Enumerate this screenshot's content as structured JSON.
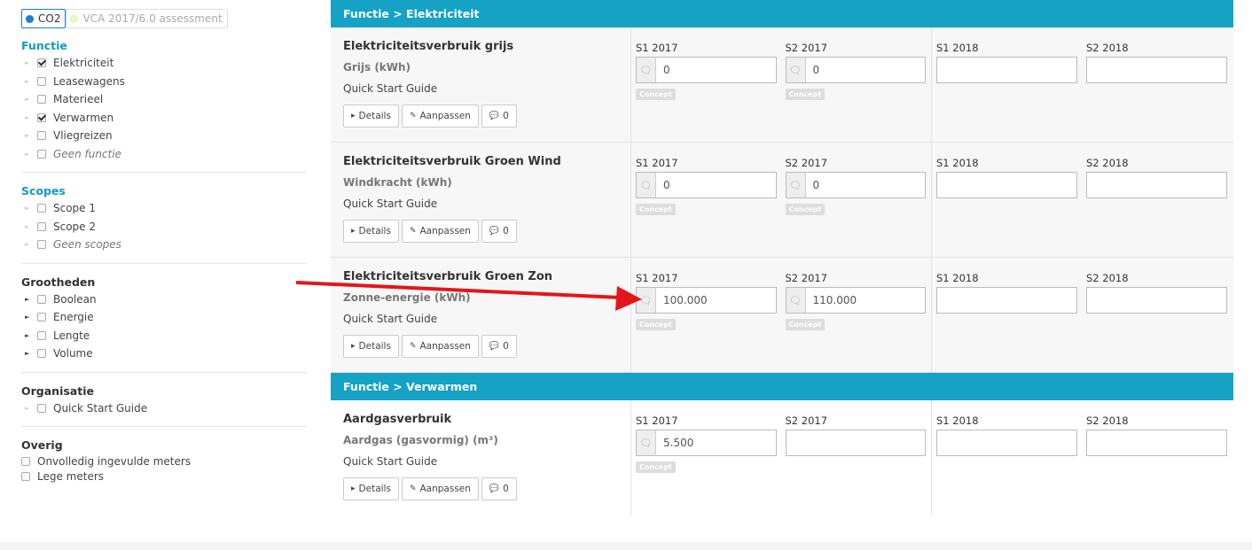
{
  "sidebar": {
    "tabs": [
      {
        "label": "CO2",
        "active": true
      },
      {
        "label": "VCA 2017/6.0 assessment",
        "active": false
      }
    ],
    "sections": [
      {
        "title": "Functie",
        "items": [
          {
            "label": "Elektriciteit",
            "checked": true
          },
          {
            "label": "Leasewagens",
            "checked": false
          },
          {
            "label": "Materieel",
            "checked": false
          },
          {
            "label": "Verwarmen",
            "checked": true
          },
          {
            "label": "Vliegreizen",
            "checked": false
          },
          {
            "label": "Geen functie",
            "checked": false
          }
        ]
      },
      {
        "title": "Scopes",
        "items": [
          {
            "label": "Scope 1",
            "checked": false
          },
          {
            "label": "Scope 2",
            "checked": false
          },
          {
            "label": "Geen scopes",
            "checked": false
          }
        ]
      },
      {
        "title": "Grootheden",
        "items": [
          {
            "label": "Boolean",
            "checked": false
          },
          {
            "label": "Energie",
            "checked": false
          },
          {
            "label": "Lengte",
            "checked": false
          },
          {
            "label": "Volume",
            "checked": false
          }
        ]
      },
      {
        "title": "Organisatie",
        "items": [
          {
            "label": "Quick Start Guide",
            "checked": false
          }
        ]
      },
      {
        "title": "Overig",
        "items": [
          {
            "label": "Onvolledig ingevulde meters",
            "checked": false
          },
          {
            "label": "Lege meters",
            "checked": false
          }
        ]
      }
    ]
  },
  "main": {
    "buttons": {
      "details": "Details",
      "edit": "Aanpassen",
      "comments": "0"
    },
    "badge": "Concept",
    "periods": [
      "S1 2017",
      "S2 2017",
      "S1 2018",
      "S2 2018"
    ],
    "groups": [
      {
        "header": "Functie > Elektriciteit",
        "meters": [
          {
            "name": "Elektriciteitsverbruik grijs",
            "unit": "Grijs (kWh)",
            "org": "Quick Start Guide",
            "values": [
              "0",
              "0",
              "",
              ""
            ]
          },
          {
            "name": "Elektriciteitsverbruik Groen Wind",
            "unit": "Windkracht (kWh)",
            "org": "Quick Start Guide",
            "values": [
              "0",
              "0",
              "",
              ""
            ]
          },
          {
            "name": "Elektriciteitsverbruik Groen Zon",
            "unit": "Zonne-energie (kWh)",
            "org": "Quick Start Guide",
            "values": [
              "100.000",
              "110.000",
              "",
              ""
            ]
          }
        ]
      },
      {
        "header": "Functie > Verwarmen",
        "meters": [
          {
            "name": "Aardgasverbruik",
            "unit": "Aardgas (gasvormig) (m³)",
            "org": "Quick Start Guide",
            "values": [
              "5.500",
              "",
              "",
              ""
            ]
          }
        ]
      }
    ]
  },
  "colors": {
    "header": "#15a2c4",
    "accent": "#1a7fd1",
    "arrow": "#e3161b"
  }
}
